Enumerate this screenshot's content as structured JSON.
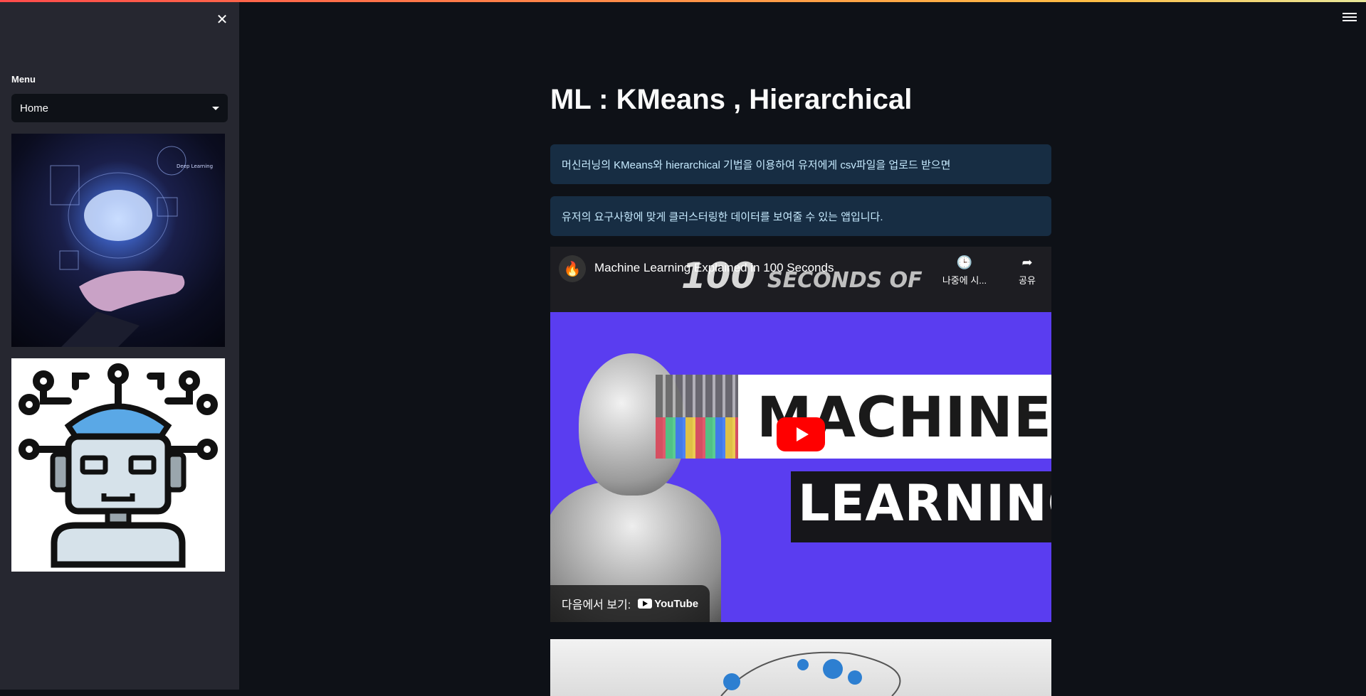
{
  "sidebar": {
    "close_icon": "close-icon",
    "menu_label": "Menu",
    "select_value": "Home",
    "images": [
      "brain-hand-image",
      "robot-icon-image"
    ],
    "brain_image_caption": "Deep Learning"
  },
  "header": {
    "menu_icon": "hamburger-icon"
  },
  "main": {
    "title": "ML : KMeans , Hierarchical",
    "info": [
      "머신러닝의 KMeans와 hierarchical 기법을 이용하여 유저에게 csv파일을 업로드 받으면",
      "유저의 요구사항에 맞게 클러스터링한 데이터를 보여줄 수 있는 앱입니다."
    ],
    "video": {
      "title": "Machine Learning Explained in 100 Seconds",
      "watch_later": "나중에 시...",
      "share": "공유",
      "watch_on": "다음에서 보기:",
      "youtube": "YouTube",
      "thumb_text_1": "100",
      "thumb_text_2": "SECONDS OF",
      "thumb_text_3": "MACHINE",
      "thumb_text_4": "LEARNING"
    }
  },
  "colors": {
    "background": "#0e1117",
    "sidebar": "#262730",
    "info_bg": "#172d43",
    "info_text": "#c7ebff",
    "youtube_red": "#ff0000"
  }
}
